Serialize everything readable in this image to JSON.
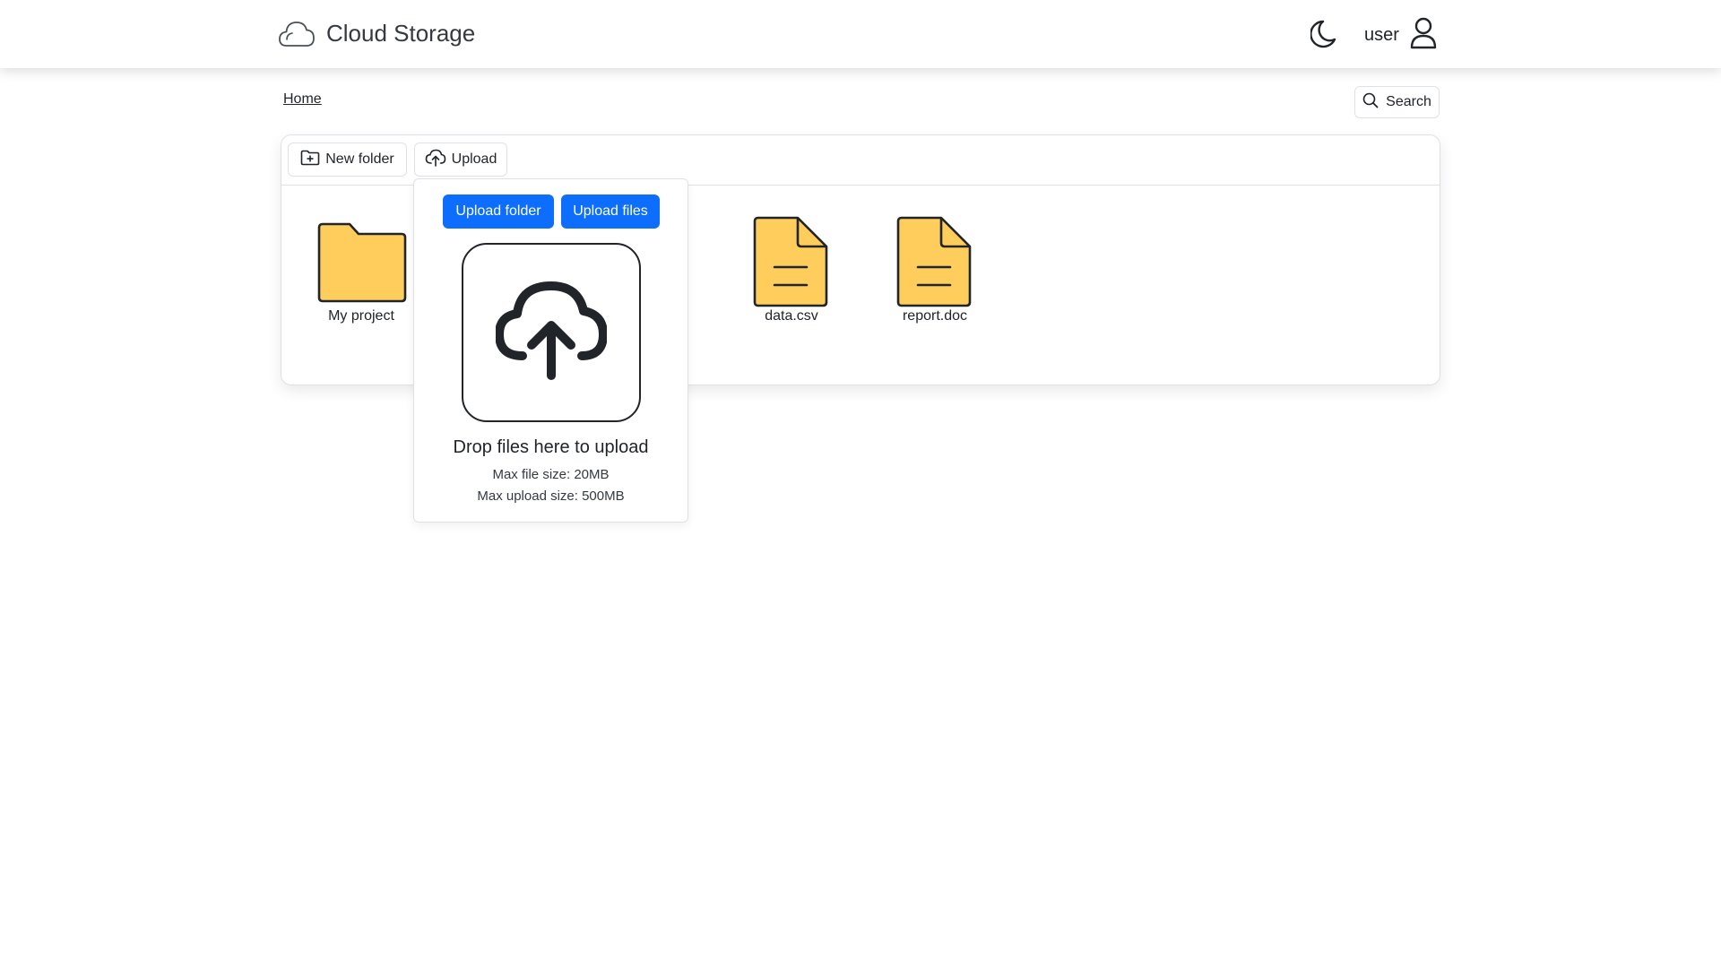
{
  "header": {
    "brand_icon": "cloud-icon",
    "title": "Cloud Storage",
    "theme_icon": "moon-icon",
    "user_name": "user",
    "user_icon": "person-icon"
  },
  "breadcrumb": {
    "home": "Home"
  },
  "search": {
    "label": "Search",
    "icon": "search-icon"
  },
  "toolbar": {
    "new_folder_label": "New folder",
    "new_folder_icon": "folder-plus-icon",
    "upload_label": "Upload",
    "upload_icon": "cloud-upload-icon"
  },
  "items": [
    {
      "name": "My project",
      "type": "folder"
    },
    {
      "name": "data.csv",
      "type": "file"
    },
    {
      "name": "report.doc",
      "type": "file"
    }
  ],
  "upload_popover": {
    "upload_folder_label": "Upload folder",
    "upload_files_label": "Upload files",
    "dropzone_icon": "cloud-upload-icon",
    "drop_title": "Drop files here to upload",
    "max_file_size": "Max file size: 20MB",
    "max_upload_size": "Max upload size: 500MB"
  },
  "colors": {
    "accent": "#0d6efd",
    "folder_fill": "#ffcd5c",
    "text": "#212529",
    "border": "#dee2e6"
  }
}
